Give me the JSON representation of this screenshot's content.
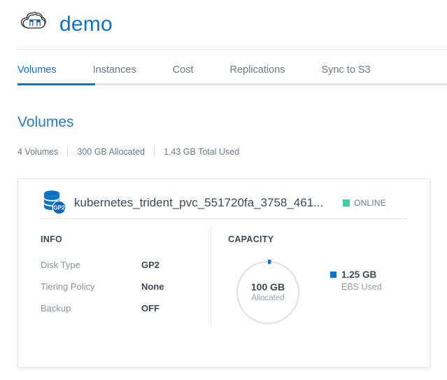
{
  "header": {
    "logo_icon": "cloud-manager-icon",
    "title": "demo",
    "title_color": "#0b72cc"
  },
  "tabs": [
    {
      "label": "Volumes",
      "active": true
    },
    {
      "label": "Instances",
      "active": false
    },
    {
      "label": "Cost",
      "active": false
    },
    {
      "label": "Replications",
      "active": false
    },
    {
      "label": "Sync to S3",
      "active": false
    }
  ],
  "section": {
    "title": "Volumes",
    "stats": [
      "4 Volumes",
      "300 GB Allocated",
      "1.43 GB Total Used"
    ]
  },
  "volume_card": {
    "disk_icon": "database-disk-icon",
    "disk_badge": "GP2",
    "name": "kubernetes_trident_pvc_551720fa_3758_461...",
    "status": {
      "label": "ONLINE",
      "color": "#38d0a4"
    },
    "info": {
      "heading": "INFO",
      "rows": [
        {
          "label": "Disk Type",
          "value": "GP2"
        },
        {
          "label": "Tiering Policy",
          "value": "None"
        },
        {
          "label": "Backup",
          "value": "OFF"
        }
      ]
    },
    "capacity": {
      "heading": "CAPACITY",
      "donut": {
        "center_value": "100 GB",
        "center_label": "Allocated",
        "used_percent": 1.25,
        "used_color": "#1272c4",
        "track_color": "#e2e5e8"
      },
      "legend": {
        "value": "1.25 GB",
        "label": "EBS Used",
        "color": "#1272c4"
      }
    }
  }
}
